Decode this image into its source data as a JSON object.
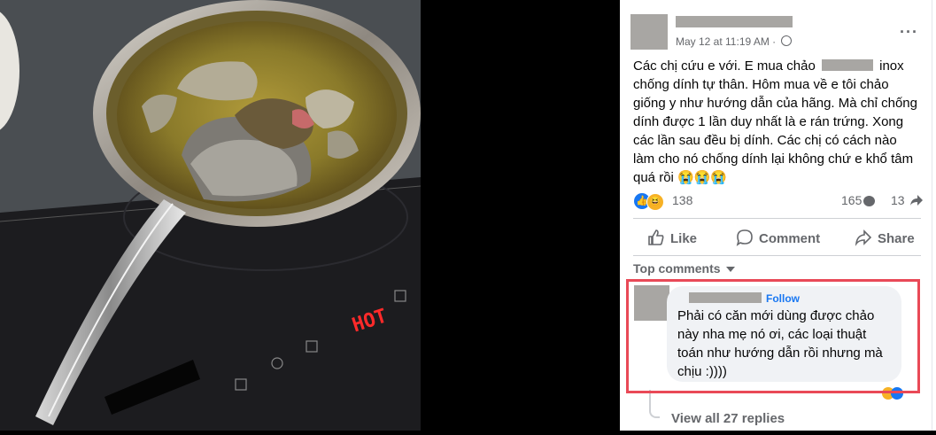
{
  "post": {
    "time": "May 12 at 11:19 AM",
    "more_icon": "more-horizontal-icon",
    "text_before_redact": "Các chị cứu e với. E mua chảo ",
    "text_after_redact": " inox chống dính tự thân. Hôm mua về e tôi chảo giống y như hướng dẫn của hãng. Mà chỉ chống dính được 1 lần duy nhất là e rán trứng. Xong các lần sau đều bị dính. Các chị có cách nào làm cho nó chống dính lại không chứ e khổ tâm quá rồi",
    "emoji_tail": "😭😭😭",
    "reactions_count": "138",
    "comments_count": "165",
    "shares_count": "13"
  },
  "actions": {
    "like": "Like",
    "comment": "Comment",
    "share": "Share"
  },
  "comments": {
    "sort_label": "Top comments",
    "follow_label": "Follow",
    "text": "Phải có căn mới dùng được chảo này nha mẹ nó ơi, các loại thuật toán như hướng dẫn rồi nhưng mà chịu :))))",
    "view_replies": "View all 27 replies"
  },
  "photo": {
    "cooktop_display": "HOT",
    "colors": {
      "cooktop": "#1a1a1c",
      "display_red": "#ff2a2a",
      "oil": "#9a8a2a"
    }
  },
  "colors": {
    "highlight": "#e94957",
    "link": "#1877f2",
    "muted": "#65676b"
  }
}
